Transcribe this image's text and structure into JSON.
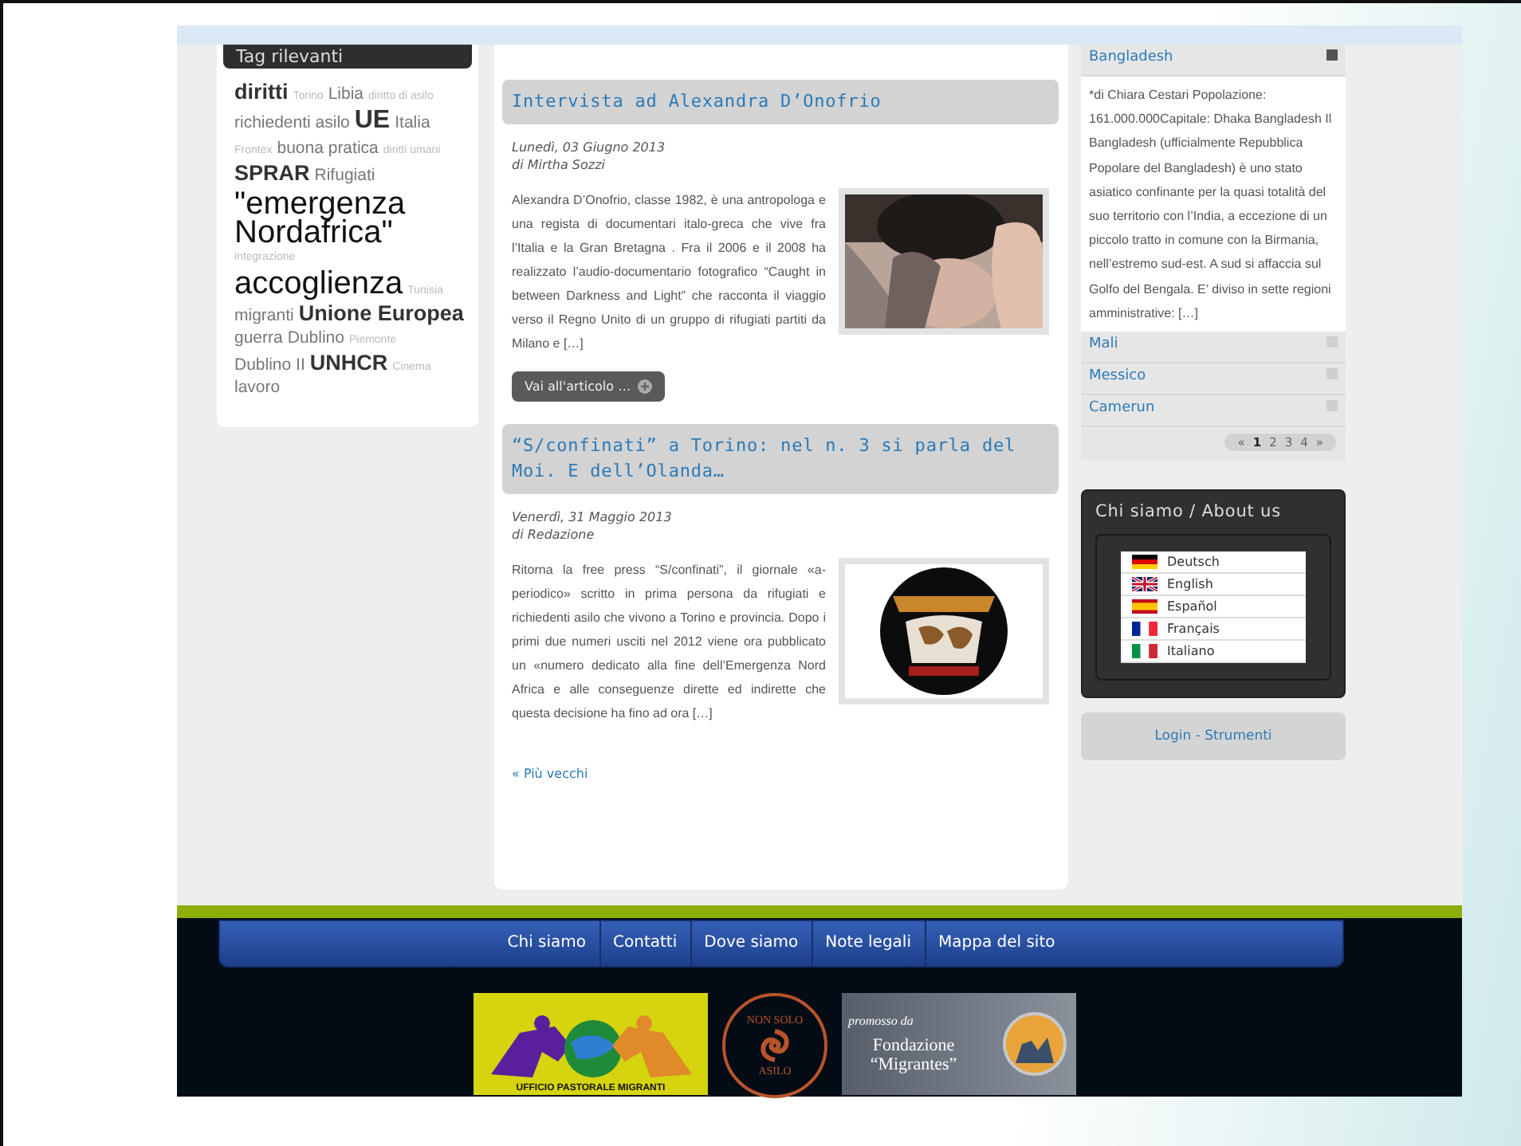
{
  "tag_cloud": {
    "title": "Tag rilevanti",
    "tags": [
      {
        "label": "diritti",
        "kind": "l"
      },
      {
        "label": "Torino",
        "kind": "xs"
      },
      {
        "label": "Libia",
        "kind": "m"
      },
      {
        "label": "diritto di asilo",
        "kind": "xs"
      },
      {
        "label": "richiedenti asilo",
        "kind": "m"
      },
      {
        "label": "UE",
        "kind": "xl"
      },
      {
        "label": "Italia",
        "kind": "m"
      },
      {
        "label": "Frontex",
        "kind": "xs"
      },
      {
        "label": "buona pratica",
        "kind": "m"
      },
      {
        "label": "diritti umani",
        "kind": "xs"
      },
      {
        "label": "SPRAR",
        "kind": "l"
      },
      {
        "label": "Rifugiati",
        "kind": "m"
      },
      {
        "label": "\"emergenza Nordafrica\"",
        "kind": "xxl"
      },
      {
        "label": "integrazione",
        "kind": "xs"
      },
      {
        "label": "accoglienza",
        "kind": "xxl"
      },
      {
        "label": "Tunisia",
        "kind": "xs"
      },
      {
        "label": "migranti",
        "kind": "m"
      },
      {
        "label": "Unione Europea",
        "kind": "l"
      },
      {
        "label": "guerra",
        "kind": "m"
      },
      {
        "label": "Dublino",
        "kind": "m"
      },
      {
        "label": "Piemonte",
        "kind": "xs"
      },
      {
        "label": "Dublino II",
        "kind": "m"
      },
      {
        "label": "UNHCR",
        "kind": "l"
      },
      {
        "label": "Cinema",
        "kind": "xs"
      },
      {
        "label": "lavoro",
        "kind": "m"
      }
    ]
  },
  "articles": [
    {
      "title": "Intervista ad Alexandra D’Onofrio",
      "date": "Lunedì, 03 Giugno 2013",
      "author": "di Mirtha Sozzi",
      "body": "Alexandra D’Onofrio, classe 1982, è una antropologa e una regista di documentari italo-greca che vive fra l’Italia e la Gran Bretagna . Fra il 2006 e il 2008 ha realizzato l’audio-documentario fotografico “Caught in between Darkness and Light” che racconta il viaggio verso il Regno Unito di un gruppo di rifugiati partiti da Milano e […]",
      "read_more": "Vai all'articolo …"
    },
    {
      "title": "“S/confinati” a Torino: nel n. 3 si parla del Moi. E dell’Olanda…",
      "date": "Venerdì, 31 Maggio 2013",
      "author": "di Redazione",
      "body": "Ritorna la free press “S/confinati”, il giornale «a-periodico» scritto in prima persona da rifugiati e richiedenti asilo che vivono a Torino e provincia. Dopo i primi due numeri usciti nel 2012 viene ora pubblicato un «numero dedicato alla fine dell’Emergenza Nord Africa e alle conseguenze dirette ed indirette che questa decisione ha fino ad ora […]"
    }
  ],
  "older_link": "« Più vecchi",
  "countries": {
    "items": [
      {
        "name": "Bangladesh",
        "expanded": true,
        "body": "*di Chiara Cestari Popolazione: 161.000.000Capitale: Dhaka Bangladesh Il Bangladesh (ufficialmente Repubblica Popolare del Bangladesh) è uno stato asiatico confinante per la quasi totalità del suo territorio con l’India, a eccezione di un piccolo tratto in comune con la Birmania, nell’estremo sud-est. A sud si affaccia sul Golfo del Bengala. E’ diviso in sette regioni amministrative: […]"
      },
      {
        "name": "Mali",
        "expanded": false
      },
      {
        "name": "Messico",
        "expanded": false
      },
      {
        "name": "Camerun",
        "expanded": false
      }
    ],
    "pagination": [
      {
        "label": "«",
        "selected": false
      },
      {
        "label": "1",
        "selected": true
      },
      {
        "label": "2",
        "selected": false
      },
      {
        "label": "3",
        "selected": false
      },
      {
        "label": "4",
        "selected": false
      },
      {
        "label": "»",
        "selected": false
      }
    ]
  },
  "about": {
    "title": "Chi siamo / About us",
    "languages": [
      "Deutsch",
      "English",
      "Español",
      "Français",
      "Italiano"
    ]
  },
  "login": "Login - Strumenti",
  "footer_nav": [
    "Chi siamo",
    "Contatti",
    "Dove siamo",
    "Note legali",
    "Mappa del sito"
  ],
  "sponsors": [
    {
      "kind": "ufficio",
      "caption": "UFFICIO PASTORALE MIGRANTI"
    },
    {
      "kind": "seal",
      "top": "NON SOLO",
      "bottom": "ASILO"
    },
    {
      "kind": "fondazione",
      "caption": "promosso da",
      "name": "Fondazione “Migrantes”"
    }
  ]
}
